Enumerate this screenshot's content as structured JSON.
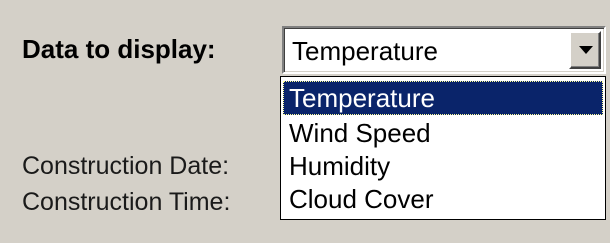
{
  "form": {
    "data_to_display_label": "Data to display:",
    "construction_date_label": "Construction Date:",
    "construction_time_label": "Construction Time:"
  },
  "combo": {
    "selected_value": "Temperature",
    "button_icon": "chevron-down-icon"
  },
  "dropdown": {
    "options": [
      {
        "label": "Temperature",
        "selected": true
      },
      {
        "label": "Wind Speed",
        "selected": false
      },
      {
        "label": "Humidity",
        "selected": false
      },
      {
        "label": "Cloud Cover",
        "selected": false
      }
    ]
  },
  "colors": {
    "background": "#d4d0c8",
    "selection": "#0a246a",
    "selection_text": "#ffffff"
  }
}
